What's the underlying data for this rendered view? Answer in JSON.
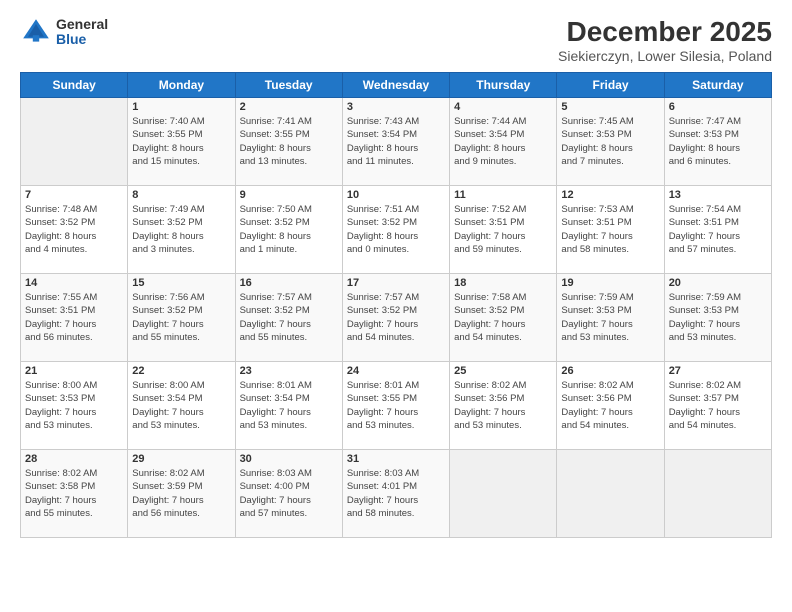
{
  "header": {
    "logo_general": "General",
    "logo_blue": "Blue",
    "month_title": "December 2025",
    "location": "Siekierczyn, Lower Silesia, Poland"
  },
  "days_of_week": [
    "Sunday",
    "Monday",
    "Tuesday",
    "Wednesday",
    "Thursday",
    "Friday",
    "Saturday"
  ],
  "weeks": [
    [
      {
        "day": "",
        "info": ""
      },
      {
        "day": "1",
        "info": "Sunrise: 7:40 AM\nSunset: 3:55 PM\nDaylight: 8 hours\nand 15 minutes."
      },
      {
        "day": "2",
        "info": "Sunrise: 7:41 AM\nSunset: 3:55 PM\nDaylight: 8 hours\nand 13 minutes."
      },
      {
        "day": "3",
        "info": "Sunrise: 7:43 AM\nSunset: 3:54 PM\nDaylight: 8 hours\nand 11 minutes."
      },
      {
        "day": "4",
        "info": "Sunrise: 7:44 AM\nSunset: 3:54 PM\nDaylight: 8 hours\nand 9 minutes."
      },
      {
        "day": "5",
        "info": "Sunrise: 7:45 AM\nSunset: 3:53 PM\nDaylight: 8 hours\nand 7 minutes."
      },
      {
        "day": "6",
        "info": "Sunrise: 7:47 AM\nSunset: 3:53 PM\nDaylight: 8 hours\nand 6 minutes."
      }
    ],
    [
      {
        "day": "7",
        "info": "Sunrise: 7:48 AM\nSunset: 3:52 PM\nDaylight: 8 hours\nand 4 minutes."
      },
      {
        "day": "8",
        "info": "Sunrise: 7:49 AM\nSunset: 3:52 PM\nDaylight: 8 hours\nand 3 minutes."
      },
      {
        "day": "9",
        "info": "Sunrise: 7:50 AM\nSunset: 3:52 PM\nDaylight: 8 hours\nand 1 minute."
      },
      {
        "day": "10",
        "info": "Sunrise: 7:51 AM\nSunset: 3:52 PM\nDaylight: 8 hours\nand 0 minutes."
      },
      {
        "day": "11",
        "info": "Sunrise: 7:52 AM\nSunset: 3:51 PM\nDaylight: 7 hours\nand 59 minutes."
      },
      {
        "day": "12",
        "info": "Sunrise: 7:53 AM\nSunset: 3:51 PM\nDaylight: 7 hours\nand 58 minutes."
      },
      {
        "day": "13",
        "info": "Sunrise: 7:54 AM\nSunset: 3:51 PM\nDaylight: 7 hours\nand 57 minutes."
      }
    ],
    [
      {
        "day": "14",
        "info": "Sunrise: 7:55 AM\nSunset: 3:51 PM\nDaylight: 7 hours\nand 56 minutes."
      },
      {
        "day": "15",
        "info": "Sunrise: 7:56 AM\nSunset: 3:52 PM\nDaylight: 7 hours\nand 55 minutes."
      },
      {
        "day": "16",
        "info": "Sunrise: 7:57 AM\nSunset: 3:52 PM\nDaylight: 7 hours\nand 55 minutes."
      },
      {
        "day": "17",
        "info": "Sunrise: 7:57 AM\nSunset: 3:52 PM\nDaylight: 7 hours\nand 54 minutes."
      },
      {
        "day": "18",
        "info": "Sunrise: 7:58 AM\nSunset: 3:52 PM\nDaylight: 7 hours\nand 54 minutes."
      },
      {
        "day": "19",
        "info": "Sunrise: 7:59 AM\nSunset: 3:53 PM\nDaylight: 7 hours\nand 53 minutes."
      },
      {
        "day": "20",
        "info": "Sunrise: 7:59 AM\nSunset: 3:53 PM\nDaylight: 7 hours\nand 53 minutes."
      }
    ],
    [
      {
        "day": "21",
        "info": "Sunrise: 8:00 AM\nSunset: 3:53 PM\nDaylight: 7 hours\nand 53 minutes."
      },
      {
        "day": "22",
        "info": "Sunrise: 8:00 AM\nSunset: 3:54 PM\nDaylight: 7 hours\nand 53 minutes."
      },
      {
        "day": "23",
        "info": "Sunrise: 8:01 AM\nSunset: 3:54 PM\nDaylight: 7 hours\nand 53 minutes."
      },
      {
        "day": "24",
        "info": "Sunrise: 8:01 AM\nSunset: 3:55 PM\nDaylight: 7 hours\nand 53 minutes."
      },
      {
        "day": "25",
        "info": "Sunrise: 8:02 AM\nSunset: 3:56 PM\nDaylight: 7 hours\nand 53 minutes."
      },
      {
        "day": "26",
        "info": "Sunrise: 8:02 AM\nSunset: 3:56 PM\nDaylight: 7 hours\nand 54 minutes."
      },
      {
        "day": "27",
        "info": "Sunrise: 8:02 AM\nSunset: 3:57 PM\nDaylight: 7 hours\nand 54 minutes."
      }
    ],
    [
      {
        "day": "28",
        "info": "Sunrise: 8:02 AM\nSunset: 3:58 PM\nDaylight: 7 hours\nand 55 minutes."
      },
      {
        "day": "29",
        "info": "Sunrise: 8:02 AM\nSunset: 3:59 PM\nDaylight: 7 hours\nand 56 minutes."
      },
      {
        "day": "30",
        "info": "Sunrise: 8:03 AM\nSunset: 4:00 PM\nDaylight: 7 hours\nand 57 minutes."
      },
      {
        "day": "31",
        "info": "Sunrise: 8:03 AM\nSunset: 4:01 PM\nDaylight: 7 hours\nand 58 minutes."
      },
      {
        "day": "",
        "info": ""
      },
      {
        "day": "",
        "info": ""
      },
      {
        "day": "",
        "info": ""
      }
    ]
  ]
}
